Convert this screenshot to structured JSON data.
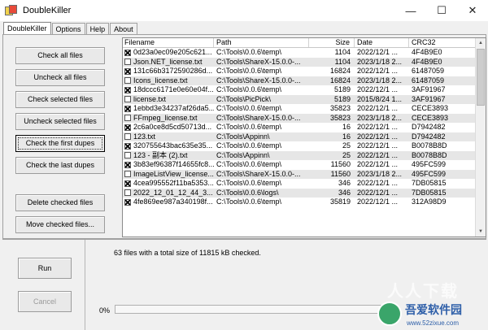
{
  "window": {
    "title": "DoubleKiller",
    "minimize": "—",
    "maximize": "☐",
    "close": "✕"
  },
  "tabs": [
    {
      "label": "DoubleKiller",
      "active": true
    },
    {
      "label": "Options",
      "active": false
    },
    {
      "label": "Help",
      "active": false
    },
    {
      "label": "About",
      "active": false
    }
  ],
  "actions": {
    "check_all": "Check all files",
    "uncheck_all": "Uncheck all files",
    "check_selected": "Check selected files",
    "uncheck_selected": "Uncheck selected files",
    "check_first_dupes": "Check the first dupes",
    "check_last_dupes": "Check the last dupes",
    "delete_checked": "Delete checked files",
    "move_checked": "Move checked files..."
  },
  "table": {
    "columns": [
      "Filename",
      "Path",
      "Size",
      "Date",
      "CRC32"
    ],
    "rows": [
      {
        "checked": true,
        "name": "0d23a0ec09e205c621...",
        "path": "C:\\Tools\\0.0.6\\temp\\",
        "size": "1104",
        "date": "2022/12/1 ...",
        "crc": "4F4B9E0"
      },
      {
        "checked": false,
        "name": "Json.NET_license.txt",
        "path": "C:\\Tools\\ShareX-15.0.0-...",
        "size": "1104",
        "date": "2023/1/18 2...",
        "crc": "4F4B9E0"
      },
      {
        "checked": true,
        "name": "131c66b3172590286d...",
        "path": "C:\\Tools\\0.0.6\\temp\\",
        "size": "16824",
        "date": "2022/12/1 ...",
        "crc": "61487059"
      },
      {
        "checked": false,
        "name": "Icons_license.txt",
        "path": "C:\\Tools\\ShareX-15.0.0-...",
        "size": "16824",
        "date": "2023/1/18 2...",
        "crc": "61487059"
      },
      {
        "checked": true,
        "name": "18dccc6171e0e60e04f...",
        "path": "C:\\Tools\\0.0.6\\temp\\",
        "size": "5189",
        "date": "2022/12/1 ...",
        "crc": "3AF91967"
      },
      {
        "checked": false,
        "name": "license.txt",
        "path": "C:\\Tools\\PicPick\\",
        "size": "5189",
        "date": "2015/8/24 1...",
        "crc": "3AF91967"
      },
      {
        "checked": true,
        "name": "1ebbd3e34237af26da5...",
        "path": "C:\\Tools\\0.0.6\\temp\\",
        "size": "35823",
        "date": "2022/12/1 ...",
        "crc": "CECE3893"
      },
      {
        "checked": false,
        "name": "FFmpeg_license.txt",
        "path": "C:\\Tools\\ShareX-15.0.0-...",
        "size": "35823",
        "date": "2023/1/18 2...",
        "crc": "CECE3893"
      },
      {
        "checked": true,
        "name": "2c6a0ce8d5cd50713d...",
        "path": "C:\\Tools\\0.0.6\\temp\\",
        "size": "16",
        "date": "2022/12/1 ...",
        "crc": "D7942482"
      },
      {
        "checked": false,
        "name": "123.txt",
        "path": "C:\\Tools\\Appinn\\",
        "size": "16",
        "date": "2022/12/1 ...",
        "crc": "D7942482"
      },
      {
        "checked": true,
        "name": "320755643bac635e35...",
        "path": "C:\\Tools\\0.0.6\\temp\\",
        "size": "25",
        "date": "2022/12/1 ...",
        "crc": "B0078B8D"
      },
      {
        "checked": false,
        "name": "123 - 副本 (2).txt",
        "path": "C:\\Tools\\Appinn\\",
        "size": "25",
        "date": "2022/12/1 ...",
        "crc": "B0078B8D"
      },
      {
        "checked": true,
        "name": "3b83ef96387f14655fc8...",
        "path": "C:\\Tools\\0.0.6\\temp\\",
        "size": "11560",
        "date": "2022/12/1 ...",
        "crc": "495FC599"
      },
      {
        "checked": false,
        "name": "ImageListView_license...",
        "path": "C:\\Tools\\ShareX-15.0.0-...",
        "size": "11560",
        "date": "2023/1/18 2...",
        "crc": "495FC599"
      },
      {
        "checked": true,
        "name": "4cea995552f11ba5353...",
        "path": "C:\\Tools\\0.0.6\\temp\\",
        "size": "346",
        "date": "2022/12/1 ...",
        "crc": "7DB05815"
      },
      {
        "checked": false,
        "name": "2022_12_01_12_44_3...",
        "path": "C:\\Tools\\0.0.6\\logs\\",
        "size": "346",
        "date": "2022/12/1 ...",
        "crc": "7DB05815"
      },
      {
        "checked": true,
        "name": "4fe869ee987a340198f...",
        "path": "C:\\Tools\\0.0.6\\temp\\",
        "size": "35819",
        "date": "2022/12/1 ...",
        "crc": "312A98D9"
      }
    ]
  },
  "bottom": {
    "run": "Run",
    "cancel": "Cancel",
    "status": "63 files with a total size of 11815 kB checked.",
    "percent": "0%",
    "progress_value": 0.0
  },
  "watermark": {
    "big": "人人下载",
    "name": "吾爱软件园",
    "url": "www.52zixue.com"
  }
}
